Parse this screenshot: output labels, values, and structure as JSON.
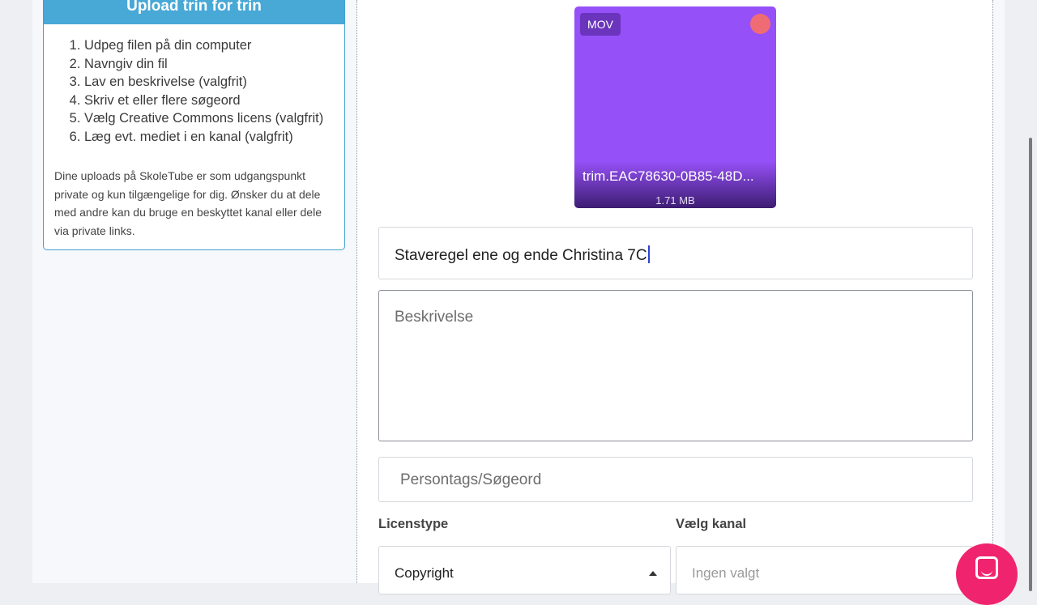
{
  "sidebar": {
    "header": "Upload trin for trin",
    "steps": [
      "Udpeg filen på din computer",
      "Navngiv din fil",
      "Lav en beskrivelse (valgfrit)",
      "Skriv et eller flere søgeord",
      "Vælg Creative Commons licens (valgfrit)",
      "Læg evt. mediet i en kanal (valgfrit)"
    ],
    "note": "Dine uploads på SkoleTube er som udgangspunkt private og kun tilgængelige for dig. Ønsker du at dele med andre kan du bruge en beskyttet kanal eller dele via private links."
  },
  "file": {
    "badge": "MOV",
    "name": "trim.EAC78630-0B85-48D...",
    "size": "1.71 MB",
    "thumb_color": "#9650f7"
  },
  "form": {
    "title_value": "Staveregel ene og ende Christina 7C",
    "description_placeholder": "Beskrivelse",
    "tags_placeholder": "Persontags/Søgeord",
    "license_label": "Licenstype",
    "license_value": "Copyright",
    "channel_label": "Vælg kanal",
    "channel_placeholder": "Ingen valgt"
  },
  "colors": {
    "accent": "#48a8d6",
    "chat": "#f0246e"
  }
}
